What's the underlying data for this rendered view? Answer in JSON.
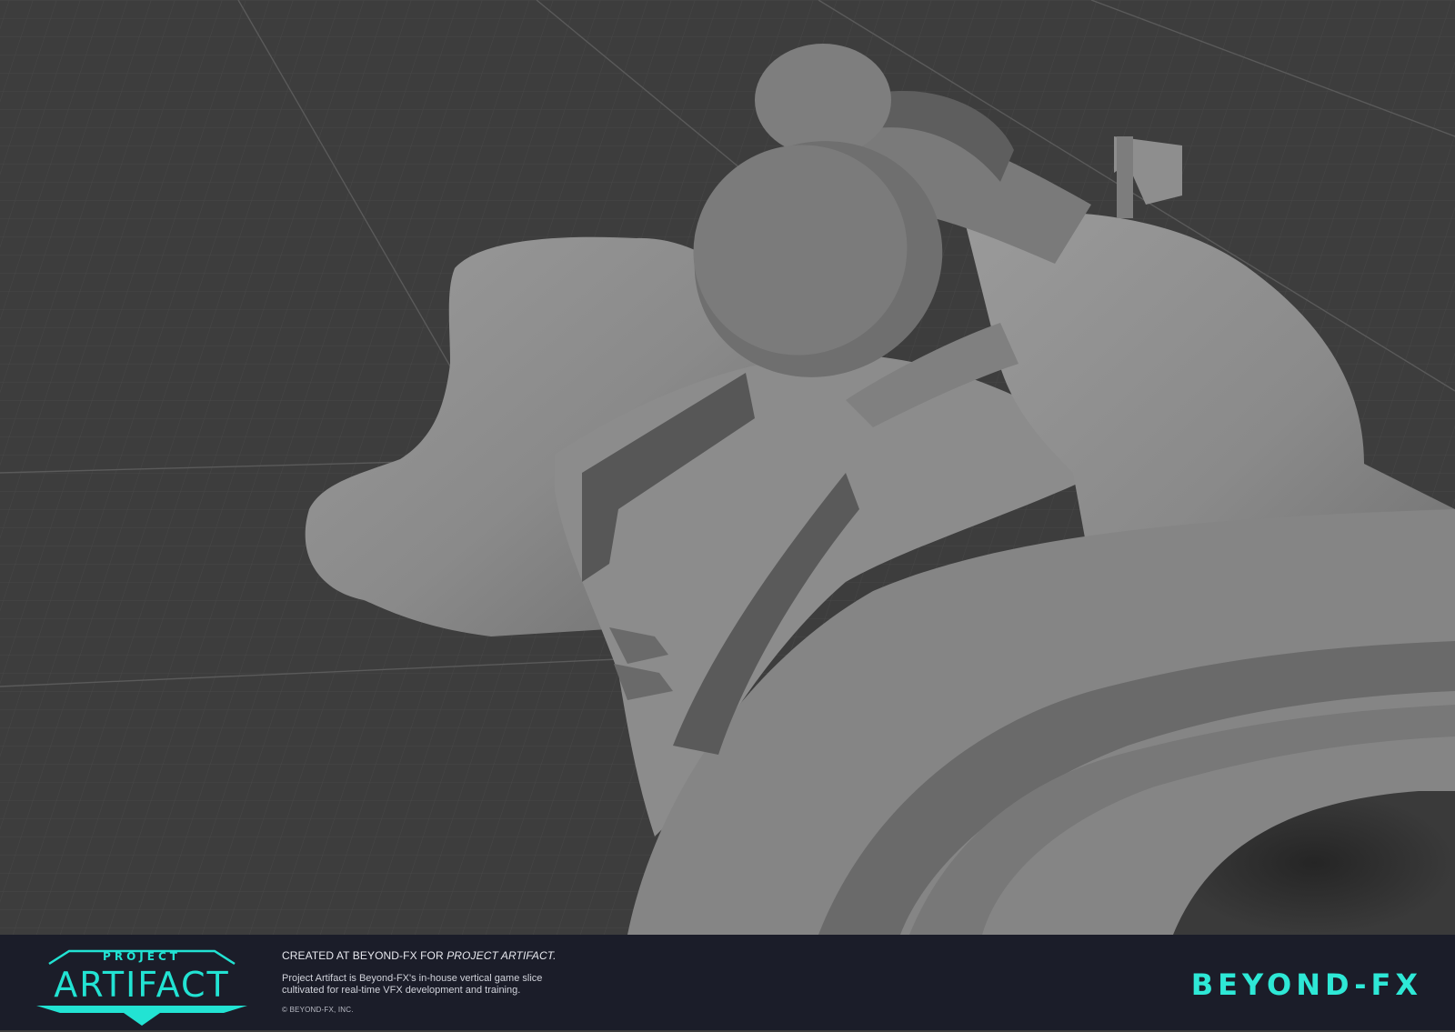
{
  "scene": {
    "subject_icon": "3d-model-render",
    "background_color": "#3d3d3d",
    "grid_color": "#4a4a4a",
    "model_color": "#8a8a8a"
  },
  "footer": {
    "logo": {
      "top_word": "PROJECT",
      "main_word": "ARTIFACT",
      "accent_color": "#22e3d3"
    },
    "credit": {
      "heading_prefix": "CREATED AT BEYOND-FX FOR ",
      "heading_emphasis": "PROJECT ARTIFACT.",
      "description": "Project Artifact is Beyond-FX's in-house vertical game slice cultivated for real-time VFX development and training.",
      "copyright": "© BEYOND-FX, INC."
    },
    "brand": {
      "wordmark": "BEYOND-FX",
      "color": "#2ee8d6"
    },
    "background_color": "#1b1d29"
  }
}
